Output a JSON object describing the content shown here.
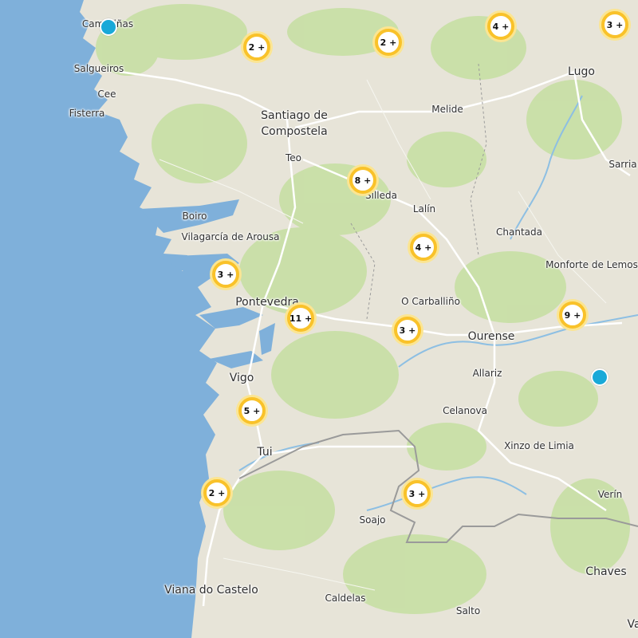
{
  "map": {
    "colors": {
      "sea": "#7fb0da",
      "land": "#e7e4d8",
      "forest": "#c7dfa4",
      "road": "#ffffff",
      "border": "#9a9a9a",
      "cluster_ring": "#f9c22a",
      "marker": "#19a9d8"
    },
    "places": [
      {
        "id": "camarinas",
        "label": "Camariñas"
      },
      {
        "id": "salgueiros",
        "label": "Salgueiros"
      },
      {
        "id": "cee",
        "label": "Cee"
      },
      {
        "id": "fisterra",
        "label": "Fisterra"
      },
      {
        "id": "santiago",
        "label": "Santiago de Compostela",
        "line1": "Santiago de",
        "line2": "Compostela"
      },
      {
        "id": "teo",
        "label": "Teo"
      },
      {
        "id": "melide",
        "label": "Melide"
      },
      {
        "id": "lugo",
        "label": "Lugo"
      },
      {
        "id": "sarria",
        "label": "Sarria"
      },
      {
        "id": "silleda",
        "label": "Silleda"
      },
      {
        "id": "lalin",
        "label": "Lalín"
      },
      {
        "id": "chantada",
        "label": "Chantada"
      },
      {
        "id": "monforte",
        "label": "Monforte de Lemos"
      },
      {
        "id": "boiro",
        "label": "Boiro"
      },
      {
        "id": "vilagarcia",
        "label": "Vilagarcía de Arousa"
      },
      {
        "id": "pontevedra",
        "label": "Pontevedra"
      },
      {
        "id": "carballino",
        "label": "O Carballiño"
      },
      {
        "id": "ourense",
        "label": "Ourense"
      },
      {
        "id": "vigo",
        "label": "Vigo"
      },
      {
        "id": "allariz",
        "label": "Allariz"
      },
      {
        "id": "celanova",
        "label": "Celanova"
      },
      {
        "id": "xinzo",
        "label": "Xinzo de Limia"
      },
      {
        "id": "tui",
        "label": "Tui"
      },
      {
        "id": "verin",
        "label": "Verín"
      },
      {
        "id": "soajo",
        "label": "Soajo"
      },
      {
        "id": "chaves",
        "label": "Chaves"
      },
      {
        "id": "viana",
        "label": "Viana do Castelo"
      },
      {
        "id": "caldelas",
        "label": "Caldelas"
      },
      {
        "id": "salto",
        "label": "Salto"
      },
      {
        "id": "va",
        "label": "Va"
      }
    ],
    "clusters": [
      {
        "id": "c1",
        "label": "2 +",
        "count": 2
      },
      {
        "id": "c2",
        "label": "2 +",
        "count": 2
      },
      {
        "id": "c3",
        "label": "4 +",
        "count": 4
      },
      {
        "id": "c4",
        "label": "3 +",
        "count": 3
      },
      {
        "id": "c5",
        "label": "8 +",
        "count": 8
      },
      {
        "id": "c6",
        "label": "4 +",
        "count": 4
      },
      {
        "id": "c7",
        "label": "3 +",
        "count": 3
      },
      {
        "id": "c8",
        "label": "11 +",
        "count": 11
      },
      {
        "id": "c9",
        "label": "3 +",
        "count": 3
      },
      {
        "id": "c10",
        "label": "9 +",
        "count": 9
      },
      {
        "id": "c11",
        "label": "5 +",
        "count": 5
      },
      {
        "id": "c12",
        "label": "2 +",
        "count": 2
      },
      {
        "id": "c13",
        "label": "3 +",
        "count": 3
      }
    ],
    "markers": [
      {
        "id": "m1",
        "icon": "location-pin-icon"
      },
      {
        "id": "m2",
        "icon": "location-pin-icon"
      }
    ]
  }
}
